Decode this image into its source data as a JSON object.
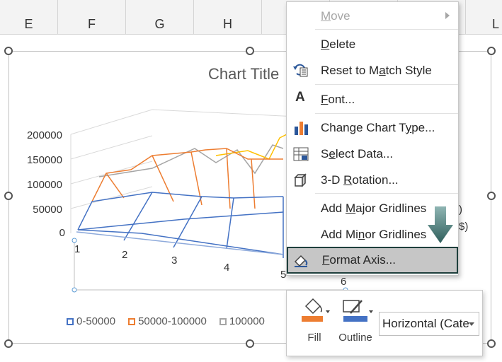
{
  "columns": [
    "E",
    "F",
    "G",
    "H",
    "",
    "",
    "",
    "L"
  ],
  "chart": {
    "title": "Chart Title",
    "y_ticks": [
      "200000",
      "150000",
      "100000",
      "50000",
      "0"
    ],
    "x_ticks": [
      "1",
      "2",
      "3",
      "4",
      "5",
      "6"
    ],
    "legend": [
      {
        "label": "0-50000",
        "color": "#4472c4"
      },
      {
        "label": "50000-100000",
        "color": "#ed7d31"
      },
      {
        "label": "100000",
        "color": "#a5a5a5"
      }
    ],
    "side_labels": [
      ")",
      "$)"
    ]
  },
  "context_menu": {
    "items": [
      {
        "pre": "",
        "ul": "M",
        "post": "ove",
        "disabled": true,
        "icon": "none",
        "submenu": true
      },
      {
        "pre": "",
        "ul": "D",
        "post": "elete",
        "disabled": false,
        "icon": "none"
      },
      {
        "pre": "Reset to M",
        "ul": "a",
        "post": "tch Style",
        "disabled": false,
        "icon": "reset-style-icon"
      },
      {
        "pre": "",
        "ul": "F",
        "post": "ont...",
        "disabled": false,
        "icon": "font-icon"
      },
      {
        "pre": "Change Chart T",
        "ul": "y",
        "post": "pe...",
        "disabled": false,
        "icon": "chart-type-icon"
      },
      {
        "pre": "S",
        "ul": "e",
        "post": "lect Data...",
        "disabled": false,
        "icon": "select-data-icon"
      },
      {
        "pre": "3-D ",
        "ul": "R",
        "post": "otation...",
        "disabled": false,
        "icon": "rotation-3d-icon"
      },
      {
        "pre": "Add ",
        "ul": "M",
        "post": "ajor Gridlines",
        "disabled": false,
        "icon": "none"
      },
      {
        "pre": "Add Mi",
        "ul": "n",
        "post": "or Gridlines",
        "disabled": false,
        "icon": "none"
      },
      {
        "pre": "",
        "ul": "F",
        "post": "ormat Axis...",
        "disabled": false,
        "icon": "format-axis-icon",
        "highlight": true
      }
    ],
    "font_icon_glyph": "A"
  },
  "mini_toolbar": {
    "fill_label": "Fill",
    "outline_label": "Outline",
    "selection_value": "Horizontal (Cate",
    "fill_color": "#ed7d31",
    "outline_color": "#4472c4"
  }
}
